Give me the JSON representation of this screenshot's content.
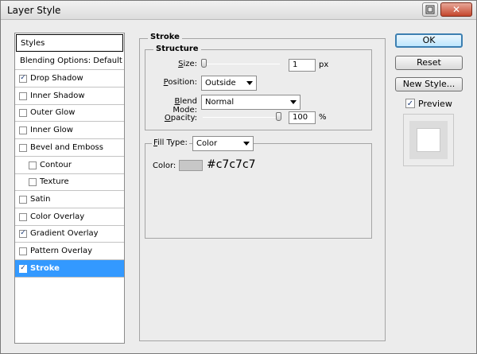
{
  "window": {
    "title": "Layer Style"
  },
  "styles_list": {
    "header": "Styles",
    "blending": "Blending Options: Default",
    "items": [
      {
        "label": "Drop Shadow",
        "checked": true,
        "indent": false
      },
      {
        "label": "Inner Shadow",
        "checked": false,
        "indent": false
      },
      {
        "label": "Outer Glow",
        "checked": false,
        "indent": false
      },
      {
        "label": "Inner Glow",
        "checked": false,
        "indent": false
      },
      {
        "label": "Bevel and Emboss",
        "checked": false,
        "indent": false
      },
      {
        "label": "Contour",
        "checked": false,
        "indent": true
      },
      {
        "label": "Texture",
        "checked": false,
        "indent": true
      },
      {
        "label": "Satin",
        "checked": false,
        "indent": false
      },
      {
        "label": "Color Overlay",
        "checked": false,
        "indent": false
      },
      {
        "label": "Gradient Overlay",
        "checked": true,
        "indent": false
      },
      {
        "label": "Pattern Overlay",
        "checked": false,
        "indent": false
      },
      {
        "label": "Stroke",
        "checked": true,
        "indent": false,
        "selected": true
      }
    ]
  },
  "stroke": {
    "group_title": "Stroke",
    "structure_title": "Structure",
    "size_label": "Size:",
    "size_value": "1",
    "size_unit": "px",
    "position_label": "Position:",
    "position_value": "Outside",
    "blend_label": "Blend Mode:",
    "blend_value": "Normal",
    "opacity_label": "Opacity:",
    "opacity_value": "100",
    "opacity_unit": "%",
    "fill_type_label": "Fill Type:",
    "fill_type_value": "Color",
    "color_label": "Color:",
    "color_hex": "#c7c7c7"
  },
  "buttons": {
    "ok": "OK",
    "reset": "Reset",
    "new_style": "New Style...",
    "preview": "Preview"
  },
  "colors": {
    "selection": "#3399ff",
    "swatch": "#c7c7c7"
  }
}
